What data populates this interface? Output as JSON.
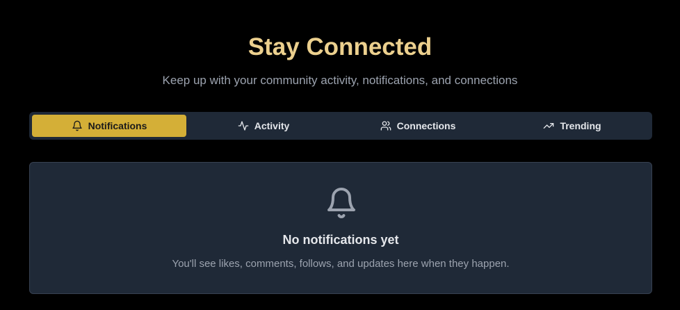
{
  "hero": {
    "title": "Stay Connected",
    "subtitle": "Keep up with your community activity, notifications, and connections"
  },
  "tabs": [
    {
      "label": "Notifications",
      "icon": "bell-icon",
      "active": true
    },
    {
      "label": "Activity",
      "icon": "activity-icon",
      "active": false
    },
    {
      "label": "Connections",
      "icon": "users-icon",
      "active": false
    },
    {
      "label": "Trending",
      "icon": "trending-up-icon",
      "active": false
    }
  ],
  "empty_state": {
    "icon": "bell-icon",
    "title": "No notifications yet",
    "message": "You'll see likes, comments, follows, and updates here when they happen."
  },
  "colors": {
    "background": "#000000",
    "accent": "#d4af37",
    "title": "#ecd08e",
    "surface": "#1f2937",
    "muted_text": "#9ca3af"
  }
}
